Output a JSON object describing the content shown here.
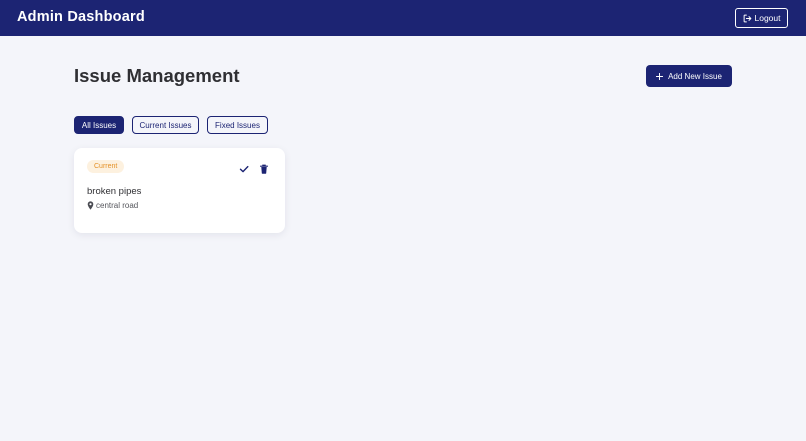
{
  "header": {
    "title": "Admin Dashboard",
    "logout_label": "Logout"
  },
  "main": {
    "title": "Issue Management",
    "add_button_label": "Add New Issue"
  },
  "filters": [
    {
      "label": "All Issues",
      "active": true
    },
    {
      "label": "Current Issues",
      "active": false
    },
    {
      "label": "Fixed Issues",
      "active": false
    }
  ],
  "issues": [
    {
      "status": "Current",
      "title": "broken pipes",
      "location": "central road",
      "icons": [
        "check-icon",
        "trash-icon",
        "map-pin-icon"
      ]
    }
  ],
  "colors": {
    "primary": "#1c2473",
    "background": "#f4f5fa",
    "status_current_bg": "#fdf1df",
    "status_current_text": "#e49127"
  }
}
